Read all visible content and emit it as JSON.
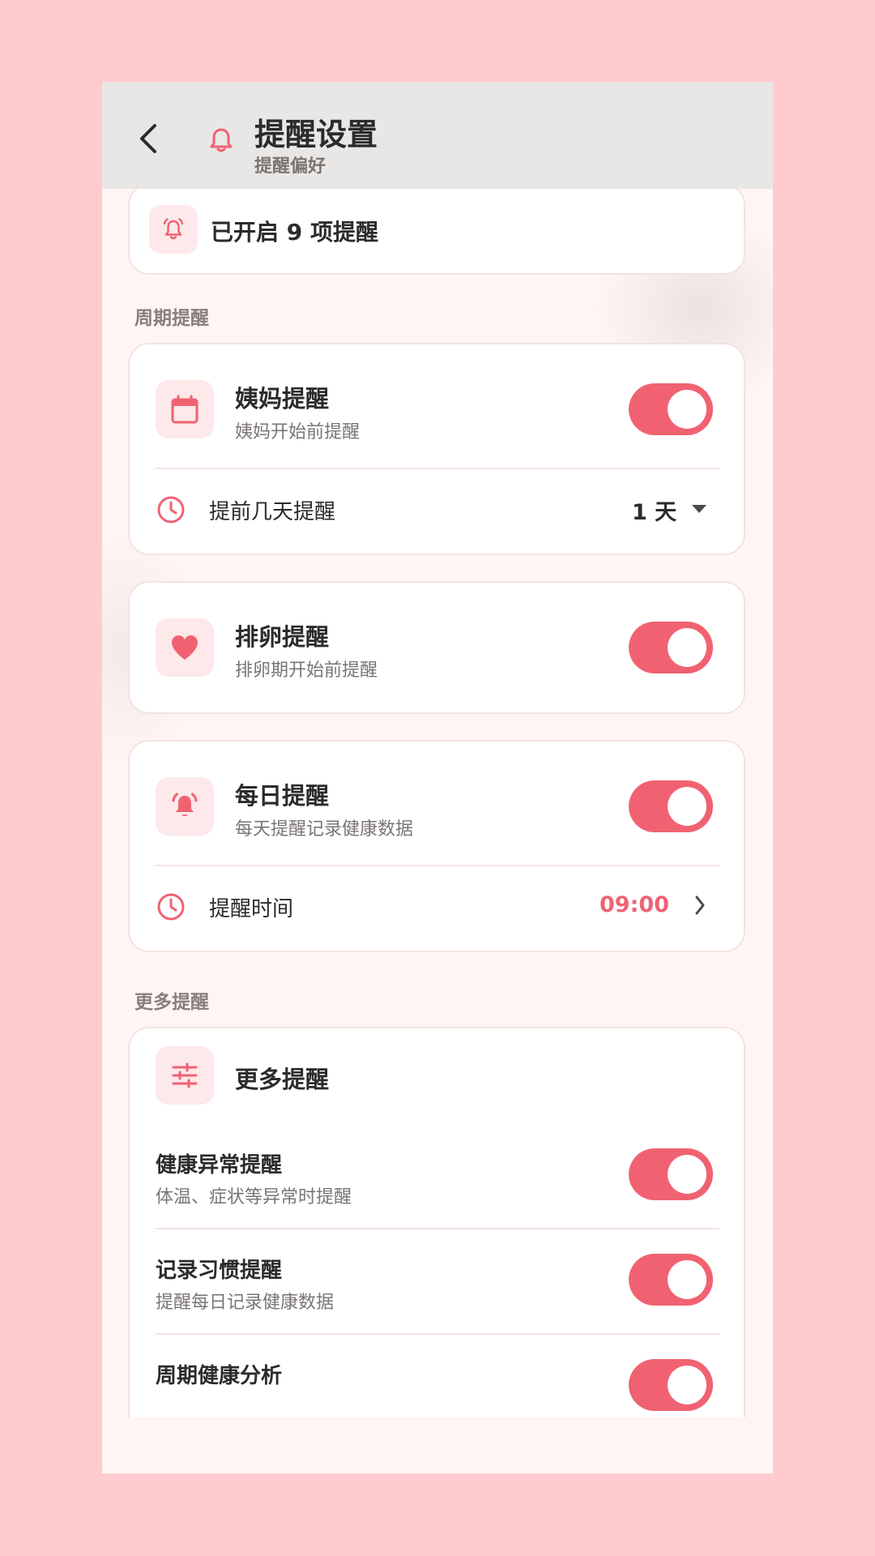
{
  "header": {
    "title": "提醒设置",
    "subtitle": "提醒偏好",
    "back_icon": "chevron-left-icon",
    "bell_icon": "bell-icon"
  },
  "summary": {
    "text": "已开启 9 项提醒",
    "icon": "bell-ring-icon"
  },
  "sections": {
    "cycle_label": "周期提醒",
    "more_label": "更多提醒"
  },
  "period": {
    "title": "姨妈提醒",
    "desc": "姨妈开始前提醒",
    "enabled": true,
    "icon": "calendar-icon",
    "advance_label": "提前几天提醒",
    "advance_value": "1 天"
  },
  "ovulation": {
    "title": "排卵提醒",
    "desc": "排卵期开始前提醒",
    "enabled": true,
    "icon": "heart-icon"
  },
  "daily": {
    "title": "每日提醒",
    "desc": "每天提醒记录健康数据",
    "enabled": true,
    "icon": "bell-icon",
    "time_label": "提醒时间",
    "time_value": "09:00"
  },
  "more": {
    "title": "更多提醒",
    "icon": "sliders-icon",
    "items": [
      {
        "title": "健康异常提醒",
        "desc": "体温、症状等异常时提醒",
        "enabled": true
      },
      {
        "title": "记录习惯提醒",
        "desc": "提醒每日记录健康数据",
        "enabled": true
      },
      {
        "title": "周期健康分析",
        "desc": "",
        "enabled": true
      }
    ]
  },
  "colors": {
    "accent": "#f06272",
    "icon_bg": "#fde8ea",
    "page_bg": "#ffcbcf",
    "header_bg": "#e9e7e5"
  }
}
